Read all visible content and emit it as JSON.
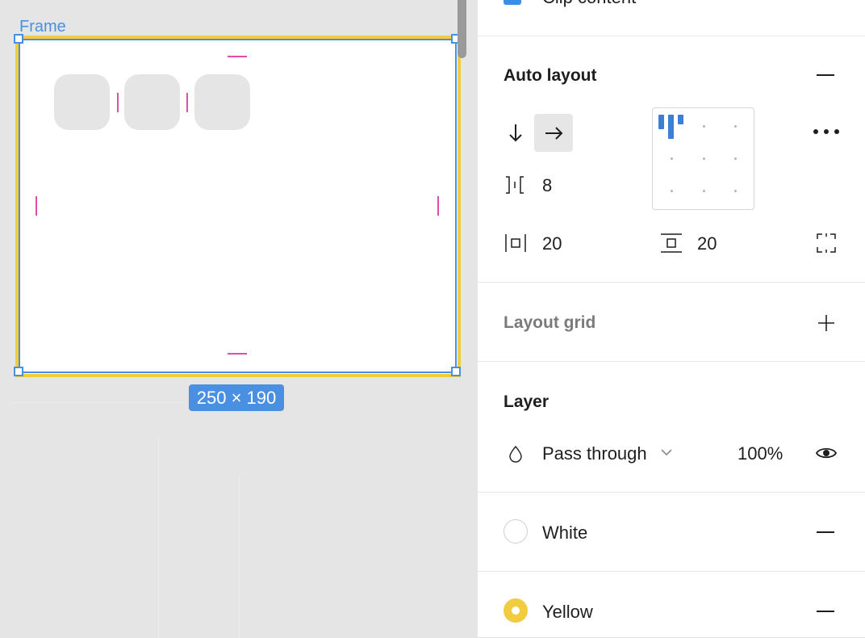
{
  "canvas": {
    "frame_label": "Frame",
    "size_badge": "250 × 190"
  },
  "panel": {
    "clip_content": {
      "label": "Clip content",
      "checked": true
    },
    "auto_layout": {
      "title": "Auto layout",
      "spacing": "8",
      "padding_horizontal": "20",
      "padding_vertical": "20"
    },
    "layout_grid": {
      "title": "Layout grid"
    },
    "layer": {
      "title": "Layer",
      "blend_mode": "Pass through",
      "opacity": "100%"
    },
    "fills": [
      {
        "name": "White",
        "color": "#ffffff"
      },
      {
        "name": "Yellow",
        "color": "#f2cc40"
      }
    ]
  },
  "colors": {
    "selection": "#4a90e2",
    "frame_stroke": "#f2cc40",
    "padding_guide": "#e04eab",
    "accent": "#3b8ee8"
  },
  "icons": [
    "arrow-down-icon",
    "arrow-right-icon",
    "more-icon",
    "spacing-icon",
    "padding-horizontal-icon",
    "padding-vertical-icon",
    "independent-padding-icon",
    "plus-icon",
    "blend-drop-icon",
    "chevron-down-icon",
    "eye-icon",
    "minus-icon"
  ]
}
